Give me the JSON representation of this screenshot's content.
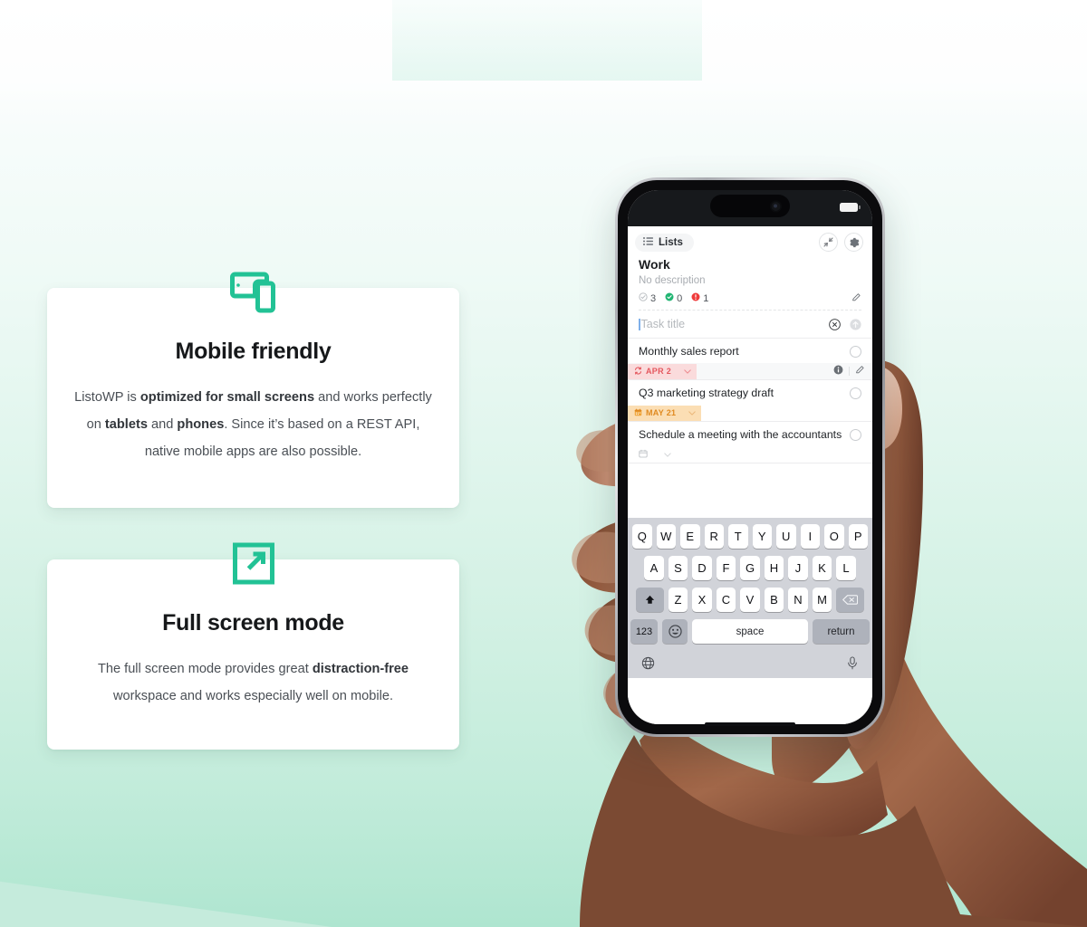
{
  "cards": [
    {
      "icon": "devices-tablet-phone-icon",
      "title": "Mobile friendly",
      "body_parts": [
        {
          "text": "ListoWP is ",
          "bold": false
        },
        {
          "text": "optimized for small screens",
          "bold": true
        },
        {
          "text": " and works perfectly on ",
          "bold": false
        },
        {
          "text": "tablets",
          "bold": true
        },
        {
          "text": " and ",
          "bold": false
        },
        {
          "text": "phones",
          "bold": true
        },
        {
          "text": ". Since it’s based on a REST API, native mobile apps are also possible.",
          "bold": false
        }
      ]
    },
    {
      "icon": "expand-arrow-fullscreen-icon",
      "title": "Full screen mode",
      "body_parts": [
        {
          "text": "The full screen mode provides great ",
          "bold": false
        },
        {
          "text": "distraction-free",
          "bold": true
        },
        {
          "text": " workspace and works especially well on mobile.",
          "bold": false
        }
      ]
    }
  ],
  "colors": {
    "accent_green": "#22c295",
    "background_top": "#ffffff",
    "background_bottom": "#aee5d0",
    "chip_red_bg": "#fadbdc",
    "chip_red_fg": "#e4575e",
    "chip_orange_bg": "#fbdeb4",
    "chip_orange_fg": "#e08a20",
    "keyboard_bg": "#d1d3d9"
  },
  "phone": {
    "app": {
      "topbar": {
        "lists_label": "Lists",
        "lists_icon": "list-lines-icon",
        "collapse_icon": "collapse-arrows-icon",
        "settings_icon": "gear-icon"
      },
      "list": {
        "title": "Work",
        "description": "No description",
        "stats": [
          {
            "icon": "circle-check-outline-icon",
            "value": "3"
          },
          {
            "icon": "circle-check-green-icon",
            "value": "0"
          },
          {
            "icon": "exclamation-red-icon",
            "value": "1"
          }
        ],
        "edit_icon": "pencil-icon"
      },
      "new_task": {
        "placeholder": "Task title",
        "value": "",
        "clear_icon": "clear-circle-x-icon",
        "add_icon": "add-arrow-icon"
      },
      "tasks": [
        {
          "title": "Monthly sales report",
          "completed": false,
          "date_label": "APR 2",
          "date_icon": "repeat-recurring-icon",
          "chip_style": "red",
          "has_actions": true,
          "info_icon": "info-icon",
          "edit_icon": "pencil-icon"
        },
        {
          "title": "Q3 marketing strategy draft",
          "completed": false,
          "date_label": "MAY 21",
          "date_icon": "calendar-icon",
          "chip_style": "orange",
          "has_actions": false
        },
        {
          "title": "Schedule a meeting with the accountants",
          "completed": false,
          "date_label": "",
          "date_icon": "calendar-outline-icon",
          "chip_style": "plain",
          "has_actions": false
        }
      ]
    },
    "keyboard": {
      "row1": [
        "Q",
        "W",
        "E",
        "R",
        "T",
        "Y",
        "U",
        "I",
        "O",
        "P"
      ],
      "row2": [
        "A",
        "S",
        "D",
        "F",
        "G",
        "H",
        "J",
        "K",
        "L"
      ],
      "row3": [
        "Z",
        "X",
        "C",
        "V",
        "B",
        "N",
        "M"
      ],
      "shift_icon": "shift-arrow-icon",
      "backspace_icon": "backspace-icon",
      "numbers_label": "123",
      "emoji_icon": "emoji-smiley-icon",
      "space_label": "space",
      "return_label": "return",
      "globe_icon": "globe-icon",
      "mic_icon": "microphone-icon"
    },
    "status": {
      "battery_icon": "battery-full-icon",
      "dynamic_island": "dynamic-island"
    }
  }
}
